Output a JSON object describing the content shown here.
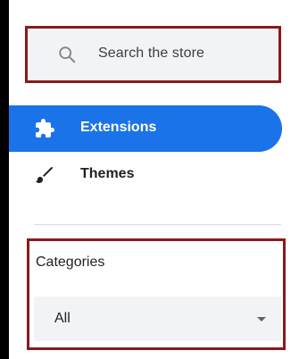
{
  "search": {
    "placeholder": "Search the store",
    "icon": "search-icon"
  },
  "nav": {
    "items": [
      {
        "label": "Extensions",
        "icon": "puzzle-piece-icon",
        "active": true
      },
      {
        "label": "Themes",
        "icon": "paintbrush-icon",
        "active": false
      }
    ]
  },
  "categories": {
    "heading": "Categories",
    "selected": "All"
  },
  "colors": {
    "accent": "#1a73e8",
    "highlight_border": "#8b1a1a",
    "field_bg": "#f1f3f4",
    "text": "#202124"
  }
}
